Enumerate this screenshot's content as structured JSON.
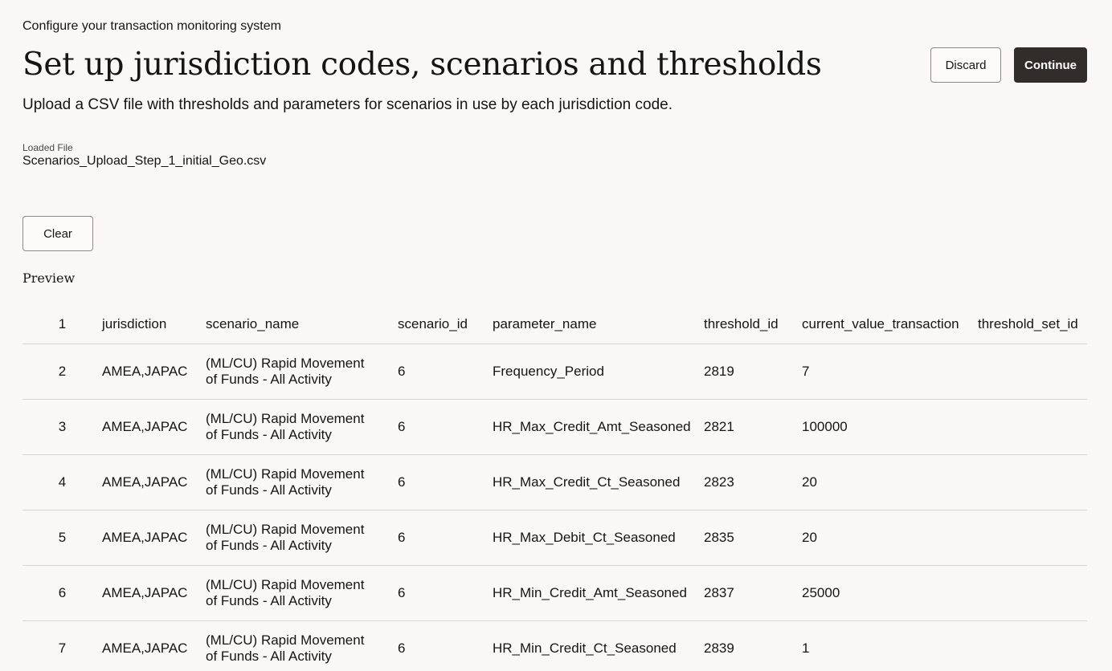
{
  "header": {
    "subtitle": "Configure your transaction monitoring system",
    "title": "Set up jurisdiction codes, scenarios and thresholds",
    "description": "Upload a CSV file with thresholds and parameters for scenarios in use by each jurisdiction code.",
    "discard_label": "Discard",
    "continue_label": "Continue"
  },
  "file": {
    "label": "Loaded File",
    "name": "Scenarios_Upload_Step_1_initial_Geo.csv",
    "clear_label": "Clear"
  },
  "preview": {
    "label": "Preview",
    "header_row": {
      "num": "1",
      "jurisdiction": "jurisdiction",
      "scenario_name": "scenario_name",
      "scenario_id": "scenario_id",
      "parameter_name": "parameter_name",
      "threshold_id": "threshold_id",
      "current_value_transaction": "current_value_transaction",
      "threshold_set_id": "threshold_set_id"
    },
    "rows": [
      {
        "num": "2",
        "jurisdiction": "AMEA,JAPAC",
        "scenario_name": "(ML/CU) Rapid Movement of Funds - All Activity",
        "scenario_id": "6",
        "parameter_name": "Frequency_Period",
        "threshold_id": "2819",
        "current_value_transaction": "7",
        "threshold_set_id": ""
      },
      {
        "num": "3",
        "jurisdiction": "AMEA,JAPAC",
        "scenario_name": "(ML/CU) Rapid Movement of Funds - All Activity",
        "scenario_id": "6",
        "parameter_name": "HR_Max_Credit_Amt_Seasoned",
        "threshold_id": "2821",
        "current_value_transaction": "100000",
        "threshold_set_id": ""
      },
      {
        "num": "4",
        "jurisdiction": "AMEA,JAPAC",
        "scenario_name": "(ML/CU) Rapid Movement of Funds - All Activity",
        "scenario_id": "6",
        "parameter_name": "HR_Max_Credit_Ct_Seasoned",
        "threshold_id": "2823",
        "current_value_transaction": "20",
        "threshold_set_id": ""
      },
      {
        "num": "5",
        "jurisdiction": "AMEA,JAPAC",
        "scenario_name": "(ML/CU) Rapid Movement of Funds - All Activity",
        "scenario_id": "6",
        "parameter_name": "HR_Max_Debit_Ct_Seasoned",
        "threshold_id": "2835",
        "current_value_transaction": "20",
        "threshold_set_id": ""
      },
      {
        "num": "6",
        "jurisdiction": "AMEA,JAPAC",
        "scenario_name": "(ML/CU) Rapid Movement of Funds - All Activity",
        "scenario_id": "6",
        "parameter_name": "HR_Min_Credit_Amt_Seasoned",
        "threshold_id": "2837",
        "current_value_transaction": "25000",
        "threshold_set_id": ""
      },
      {
        "num": "7",
        "jurisdiction": "AMEA,JAPAC",
        "scenario_name": "(ML/CU) Rapid Movement of Funds - All Activity",
        "scenario_id": "6",
        "parameter_name": "HR_Min_Credit_Ct_Seasoned",
        "threshold_id": "2839",
        "current_value_transaction": "1",
        "threshold_set_id": ""
      }
    ]
  }
}
